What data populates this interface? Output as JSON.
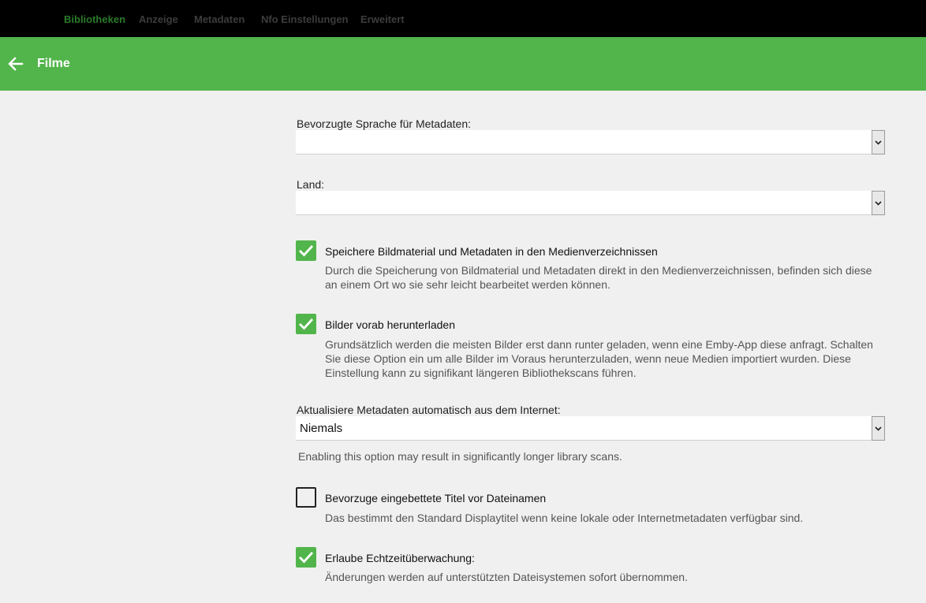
{
  "nav": {
    "tabs": [
      {
        "label": "Bibliotheken",
        "active": true
      },
      {
        "label": "Anzeige",
        "active": false
      },
      {
        "label": "Metadaten",
        "active": false
      },
      {
        "label": "Nfo Einstellungen",
        "active": false
      },
      {
        "label": "Erweitert",
        "active": false
      }
    ]
  },
  "header": {
    "title": "Filme",
    "back_icon": "arrow-left-icon"
  },
  "form": {
    "language_label": "Bevorzugte Sprache für Metadaten:",
    "language_value": "",
    "country_label": "Land:",
    "country_value": "",
    "save_local": {
      "checked": true,
      "label": "Speichere Bildmaterial und Metadaten in den Medienverzeichnissen",
      "desc": "Durch die Speicherung von Bildmaterial und Metadaten direkt in den Medienverzeichnissen, befinden sich diese an einem Ort wo sie sehr leicht bearbeitet werden können."
    },
    "download_images": {
      "checked": true,
      "label": "Bilder vorab herunterladen",
      "desc": "Grundsätzlich werden die meisten Bilder erst dann runter geladen, wenn eine Emby-App diese anfragt. Schalten Sie diese Option ein um alle Bilder im Voraus herunterzuladen, wenn neue Medien importiert wurden. Diese Einstellung kann zu signifikant längeren Bibliothekscans führen."
    },
    "auto_refresh_label": "Aktualisiere Metadaten automatisch aus dem Internet:",
    "auto_refresh_value": "Niemals",
    "auto_refresh_note": "Enabling this option may result in significantly longer library scans.",
    "embedded_titles": {
      "checked": false,
      "label": "Bevorzuge eingebettete Titel vor Dateinamen",
      "desc": "Das bestimmt den Standard Displaytitel wenn keine lokale oder Internetmetadaten verfügbar sind."
    },
    "realtime_monitor": {
      "checked": true,
      "label": "Erlaube Echtzeitüberwachung:",
      "desc": "Änderungen werden auf unterstützten Dateisystemen sofort übernommen."
    }
  },
  "colors": {
    "accent": "#52b54b",
    "active_tab": "#2a7a2a",
    "topbar": "#000000",
    "background": "#f0f0f0"
  }
}
